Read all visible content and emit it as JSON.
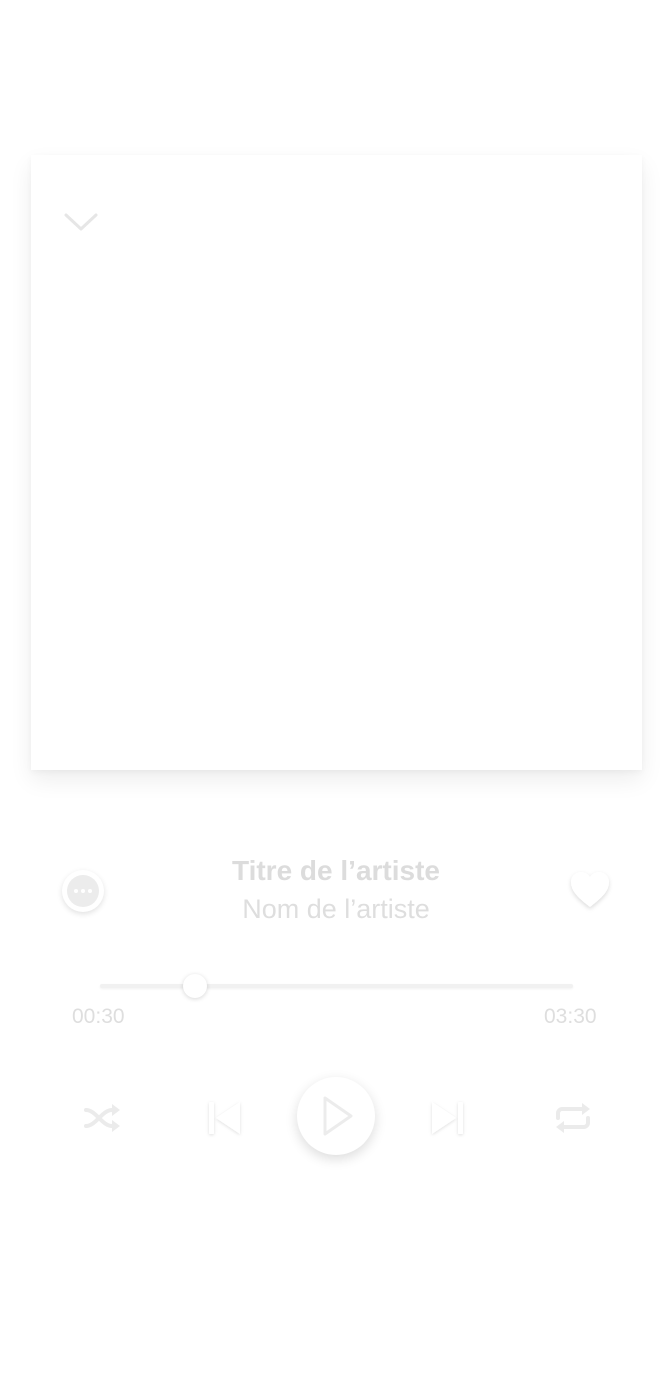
{
  "player": {
    "track_title": "Titre de l’artiste",
    "artist_name": "Nom de l’artiste",
    "elapsed_time": "00:30",
    "total_time": "03:30",
    "progress_fraction": 0.2
  },
  "icons": {
    "collapse": "chevron-down-icon",
    "more": "more-options-icon",
    "favorite": "heart-icon",
    "shuffle": "shuffle-icon",
    "previous": "skip-previous-icon",
    "play": "play-icon",
    "next": "skip-next-icon",
    "repeat": "repeat-icon"
  },
  "colors": {
    "background": "#ffffff",
    "text_primary": "#dcdcdc",
    "text_secondary": "#dedede",
    "icon": "#ececec"
  }
}
